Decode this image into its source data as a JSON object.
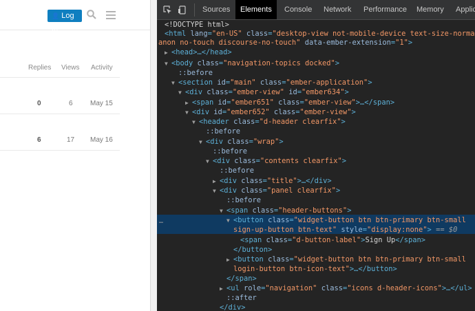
{
  "page": {
    "login_label": "Log In",
    "columns": [
      "Replies",
      "Views",
      "Activity"
    ],
    "rows": [
      {
        "replies": "0",
        "views": "6",
        "activity": "May 15"
      },
      {
        "replies": "6",
        "views": "17",
        "activity": "May 16"
      }
    ]
  },
  "devtools": {
    "tabs": [
      "Sources",
      "Elements",
      "Console",
      "Network",
      "Performance",
      "Memory",
      "Applic"
    ],
    "active_tab": "Elements",
    "lines": {
      "doctype": "<!DOCTYPE html>",
      "html_open": "<html",
      "html_lang_attr": "lang",
      "html_lang_val": "\"en-US\"",
      "html_class_attr": "class",
      "html_class_val1": "\"desktop-view not-mobile-device text-size-normal",
      "html_class_val2": "anon no-touch discourse-no-touch\"",
      "html_ember_attr": "data-ember-extension",
      "html_ember_val": "\"1\"",
      "head": "<head>…</head>",
      "body_open": "<body",
      "body_class_val": "\"navigation-topics docked\"",
      "before": "::before",
      "after": "::after",
      "section_id_val": "\"main\"",
      "section_class_val": "\"ember-application\"",
      "div634_class_val": "\"ember-view\"",
      "div634_id_val": "\"ember634\"",
      "span651_id_val": "\"ember651\"",
      "span651_class_val": "\"ember-view\"",
      "div652_id_val": "\"ember652\"",
      "div652_class_val": "\"ember-view\"",
      "header_class_val": "\"d-header clearfix\"",
      "wrap_class_val": "\"wrap\"",
      "contents_class_val": "\"contents clearfix\"",
      "title_class_val": "\"title\"",
      "panel_class_val": "\"panel clearfix\"",
      "hbtn_class_val": "\"header-buttons\"",
      "btn1_class_val1": "\"widget-button btn btn-primary btn-small",
      "btn1_class_val2": "sign-up-button btn-text\"",
      "btn1_style_val": "\"display:none\"",
      "eq": "==",
      "sel": "$0",
      "span_label_class_val": "\"d-button-label\"",
      "signup_text": "Sign Up",
      "btn2_class_val1": "\"widget-button btn btn-primary btn-small",
      "btn2_class_val2": "login-button btn-icon-text\"",
      "ul_role_val": "\"navigation\"",
      "ul_class_val": "\"icons d-header-icons\"",
      "ellipsis": "…"
    }
  }
}
